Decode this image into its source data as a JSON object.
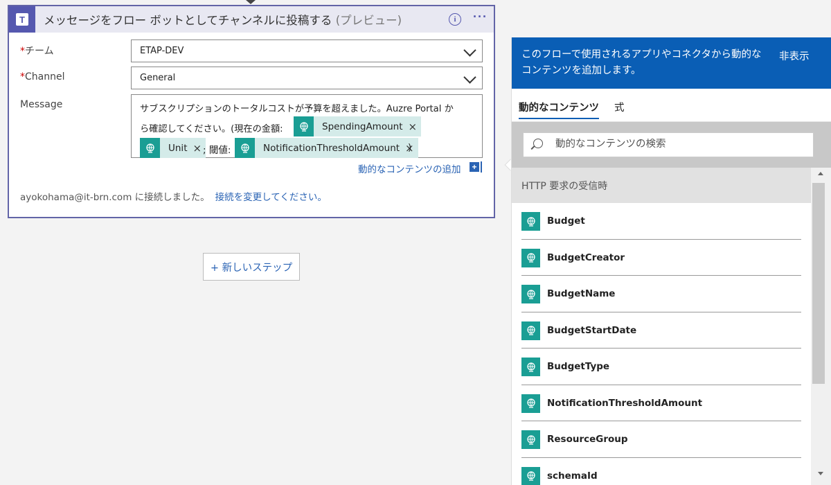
{
  "card": {
    "title": "メッセージをフロー ボットとしてチャンネルに投稿する",
    "title_suffix": "(プレビュー)",
    "team_label": "チーム",
    "team_value": "ETAP-DEV",
    "channel_label": "Channel",
    "channel_value": "General",
    "message_label": "Message",
    "message_line1": "サブスクリプションのトータルコストが予算を超えました。Auzre Portal か",
    "message_line2": "ら確認してください。(現在の金額:",
    "tokens": [
      "SpendingAmount",
      "Unit",
      "NotificationThresholdAmount"
    ],
    "separator_text": "; 閾値:",
    "closing_text": ")",
    "add_dynamic_label": "動的なコンテンツの追加",
    "connection_text": "ayokohama@it-brn.com に接続しました。",
    "connection_link": "接続を変更してください。",
    "required_mark": "*",
    "info_glyph": "i",
    "more_glyph": "···",
    "close_glyph": "×",
    "plus_glyph": "+"
  },
  "new_step_label": "+ 新しいステップ",
  "panel": {
    "description": "このフローで使用されるアプリやコネクタから動的なコンテンツを追加します。",
    "hide_label": "非表示",
    "tabs": [
      "動的なコンテンツ",
      "式"
    ],
    "search_placeholder": "動的なコンテンツの検索",
    "section_title": "HTTP 要求の受信時",
    "items": [
      "Budget",
      "BudgetCreator",
      "BudgetName",
      "BudgetStartDate",
      "BudgetType",
      "NotificationThresholdAmount",
      "ResourceGroup",
      "schemaId"
    ]
  },
  "colors": {
    "accent": "#6264a7",
    "panel_header": "#0a5eb5",
    "token_icon": "#1a9e94",
    "token_bg": "#d4ebe9",
    "link": "#2a63b4"
  }
}
